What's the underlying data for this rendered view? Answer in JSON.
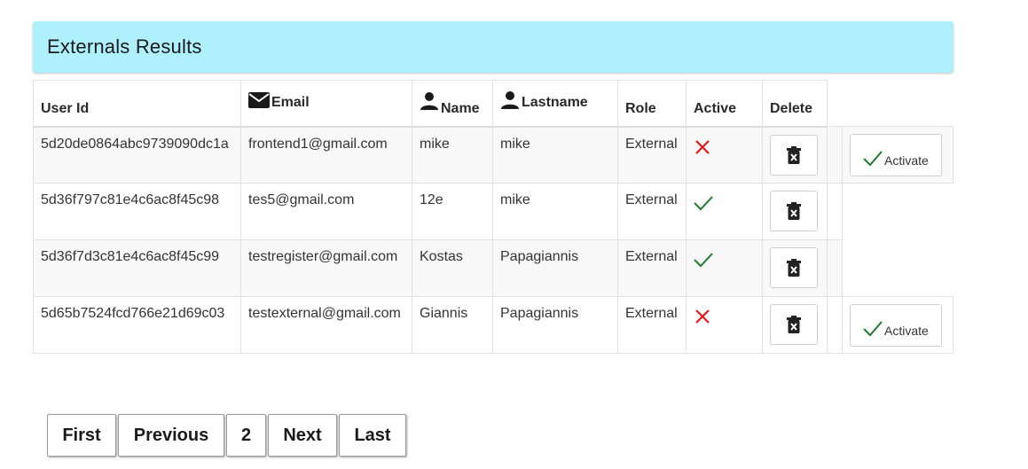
{
  "header": {
    "title": "Externals Results"
  },
  "table": {
    "columns": {
      "user_id": "User Id",
      "email": "Email",
      "name": "Name",
      "lastname": "Lastname",
      "role": "Role",
      "active": "Active",
      "delete": "Delete"
    },
    "rows": [
      {
        "user_id": "5d20de0864abc9739090dc1a",
        "email": "frontend1@gmail.com",
        "name": "mike",
        "lastname": "mike",
        "role": "External",
        "active": false,
        "activate_label": "Activate"
      },
      {
        "user_id": "5d36f797c81e4c6ac8f45c98",
        "email": "tes5@gmail.com",
        "name": "12e",
        "lastname": "mike",
        "role": "External",
        "active": true
      },
      {
        "user_id": "5d36f7d3c81e4c6ac8f45c99",
        "email": "testregister@gmail.com",
        "name": "Kostas",
        "lastname": "Papagiannis",
        "role": "External",
        "active": true
      },
      {
        "user_id": "5d65b7524fcd766e21d69c03",
        "email": "testexternal@gmail.com",
        "name": "Giannis",
        "lastname": "Papagiannis",
        "role": "External",
        "active": false,
        "activate_label": "Activate"
      }
    ]
  },
  "pagination": {
    "first": "First",
    "previous": "Previous",
    "current": "2",
    "next": "Next",
    "last": "Last"
  },
  "colors": {
    "header_bg": "#aef0fb",
    "inactive_x": "#e0191e",
    "active_check": "#1f7a2e"
  }
}
